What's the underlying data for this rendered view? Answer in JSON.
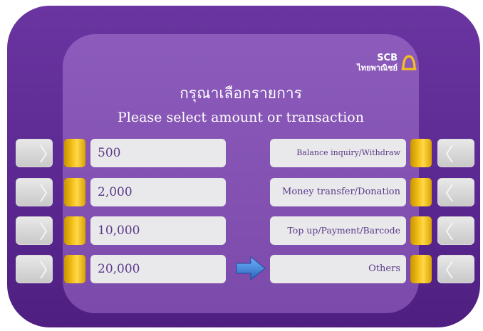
{
  "brand": {
    "name_en": "SCB",
    "name_th": "ไทยพาณิชย์",
    "icon": "bell-icon"
  },
  "title_th": "กรุณาเลือกรายการ",
  "title_en": "Please select amount or transaction",
  "amounts": [
    "500",
    "2,000",
    "10,000",
    "20,000"
  ],
  "transactions": [
    "Balance inquiry/Withdraw",
    "Money transfer/Donation",
    "Top up/Payment/Barcode",
    "Others"
  ],
  "colors": {
    "frame": "#5c2a8f",
    "screen": "#8c5bbb",
    "key": "#f6c21a",
    "field": "#e9e9ec",
    "text": "#5b3a87",
    "arrow": "#3b7fd3"
  }
}
